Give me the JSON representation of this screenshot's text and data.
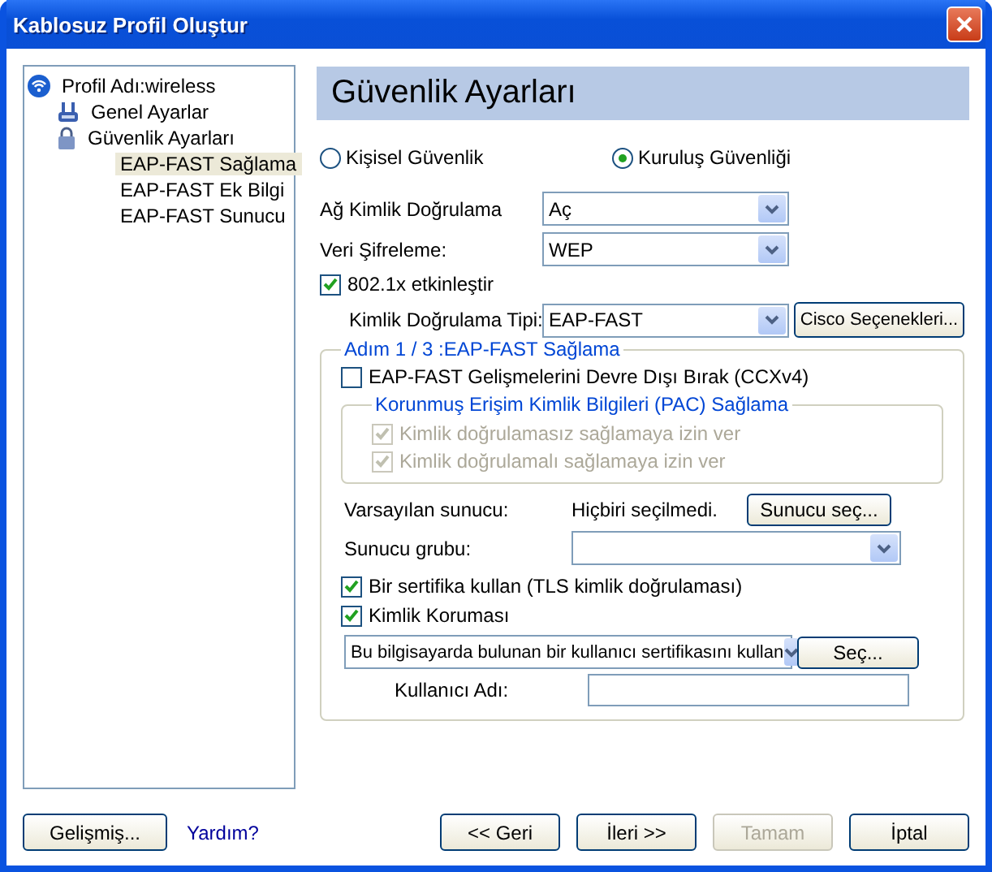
{
  "window": {
    "title": "Kablosuz Profil Oluştur"
  },
  "tree": [
    {
      "label": "Profil Adı:wireless",
      "kind": "wireless",
      "selected": false,
      "children": [
        {
          "label": "Genel Ayarlar",
          "kind": "general",
          "selected": false
        },
        {
          "label": "Güvenlik Ayarları",
          "kind": "lock",
          "selected": false,
          "children": [
            {
              "label": "EAP-FAST Sağlama",
              "kind": "page",
              "selected": true
            },
            {
              "label": "EAP-FAST Ek Bilgi",
              "kind": "page",
              "selected": false
            },
            {
              "label": "EAP-FAST Sunucu",
              "kind": "page",
              "selected": false
            }
          ]
        }
      ]
    }
  ],
  "header": "Güvenlik Ayarları",
  "security_type": [
    {
      "label": "Kişisel Güvenlik",
      "selected": false
    },
    {
      "label": "Kuruluş Güvenliği",
      "selected": true
    }
  ],
  "network_auth": {
    "label": "Ağ Kimlik Doğrulama",
    "value": "Aç"
  },
  "data_encryption": {
    "label": "Veri Şifreleme:",
    "value": "WEP"
  },
  "enable_8021x": {
    "label": "802.1x etkinleştir",
    "checked": true
  },
  "auth_type": {
    "label": "Kimlik Doğrulama Tipi:",
    "value": "EAP-FAST",
    "button": "Cisco Seçenekleri..."
  },
  "step_group": {
    "legend": "Adım 1 / 3 :EAP-FAST Sağlama",
    "disable_extensions": {
      "label": "EAP-FAST Gelişmelerini Devre Dışı Bırak (CCXv4)",
      "checked": false
    },
    "pac_group": {
      "legend": "Korunmuş Erişim Kimlik Bilgileri (PAC) Sağlama",
      "options": [
        {
          "label": "Kimlik doğrulamasız sağlamaya izin ver",
          "checked": true,
          "disabled": true
        },
        {
          "label": "Kimlik doğrulamalı sağlamaya izin ver",
          "checked": true,
          "disabled": true
        }
      ]
    },
    "default_server": {
      "label": "Varsayılan sunucu:",
      "value": "Hiçbiri seçilmedi.",
      "button": "Sunucu seç..."
    },
    "server_group": {
      "label": "Sunucu grubu:"
    },
    "options": [
      {
        "label": "Bir sertifika kullan (TLS kimlik doğrulaması)",
        "checked": true
      },
      {
        "label": "Kimlik Koruması",
        "checked": true
      }
    ],
    "certificate": {
      "value": "Bu bilgisayarda bulunan bir kullanıcı sertifikasını kullan",
      "button": "Seç..."
    },
    "username": {
      "label": "Kullanıcı Adı:"
    }
  },
  "footer": {
    "advanced": "Gelişmiş...",
    "help": "Yardım?",
    "buttons": [
      {
        "label": "<< Geri",
        "disabled": false
      },
      {
        "label": "İleri >>",
        "disabled": false
      },
      {
        "label": "Tamam",
        "disabled": true
      },
      {
        "label": "İptal",
        "disabled": false
      }
    ]
  }
}
